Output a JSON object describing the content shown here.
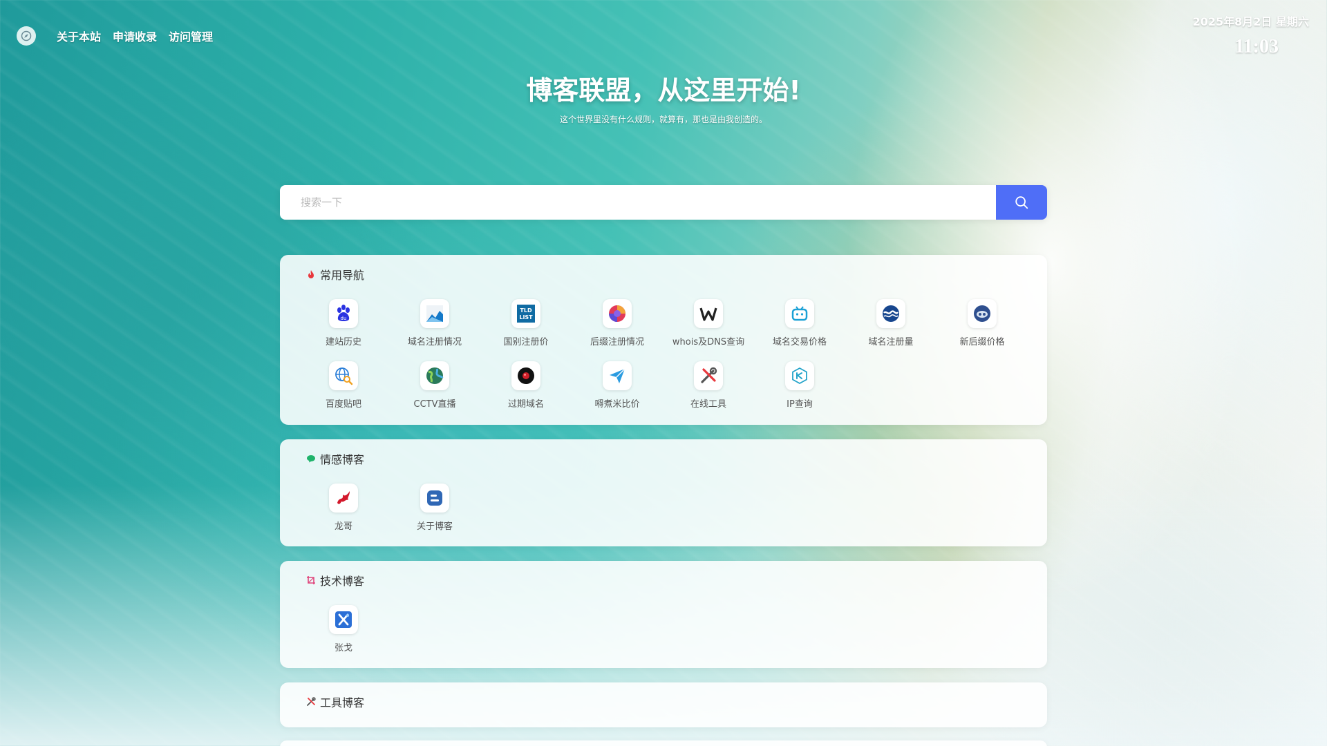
{
  "nav": {
    "items": [
      {
        "label": "关于本站"
      },
      {
        "label": "申请收录"
      },
      {
        "label": "访问管理"
      }
    ]
  },
  "clock": {
    "date": "2025年8月2日 星期六",
    "time": "11:03"
  },
  "hero": {
    "title": "博客联盟，从这里开始!",
    "subtitle": "这个世界里没有什么规则，就算有，那也是由我创造的。"
  },
  "search": {
    "placeholder": "搜索一下",
    "value": ""
  },
  "colors": {
    "accent": "#4f6ef7",
    "hot": "#e8383d",
    "green": "#1fb36b",
    "pink": "#e0457b"
  },
  "sections": [
    {
      "title": "常用导航",
      "icon": "flame-icon",
      "items": [
        {
          "label": "建站历史",
          "icon": "baidu-paw-icon"
        },
        {
          "label": "域名注册情况",
          "icon": "chart-mountain-icon"
        },
        {
          "label": "国别注册价",
          "icon": "tld-list-icon"
        },
        {
          "label": "后缀注册情况",
          "icon": "colorful-circle-icon"
        },
        {
          "label": "whois及DNS查询",
          "icon": "letter-w-icon"
        },
        {
          "label": "域名交易价格",
          "icon": "tv-bot-icon"
        },
        {
          "label": "域名注册量",
          "icon": "wave-badge-icon"
        },
        {
          "label": "新后缀价格",
          "icon": "robot-face-icon"
        },
        {
          "label": "百度贴吧",
          "icon": "globe-search-icon"
        },
        {
          "label": "CCTV直播",
          "icon": "green-globe-icon"
        },
        {
          "label": "过期域名",
          "icon": "dark-orb-icon"
        },
        {
          "label": "嘚煮米比价",
          "icon": "paper-plane-icon"
        },
        {
          "label": "在线工具",
          "icon": "tools-icon"
        },
        {
          "label": "IP查询",
          "icon": "ip-hexagon-icon"
        }
      ]
    },
    {
      "title": "情感博客",
      "icon": "chat-bubble-icon",
      "items": [
        {
          "label": "龙哥",
          "icon": "red-dragon-icon"
        },
        {
          "label": "关于博客",
          "icon": "blogger-icon"
        }
      ]
    },
    {
      "title": "技术博客",
      "icon": "crop-icon",
      "items": [
        {
          "label": "张戈",
          "icon": "blue-x-icon"
        }
      ]
    },
    {
      "title": "工具博客",
      "icon": "wrench-cross-icon",
      "items": []
    }
  ]
}
